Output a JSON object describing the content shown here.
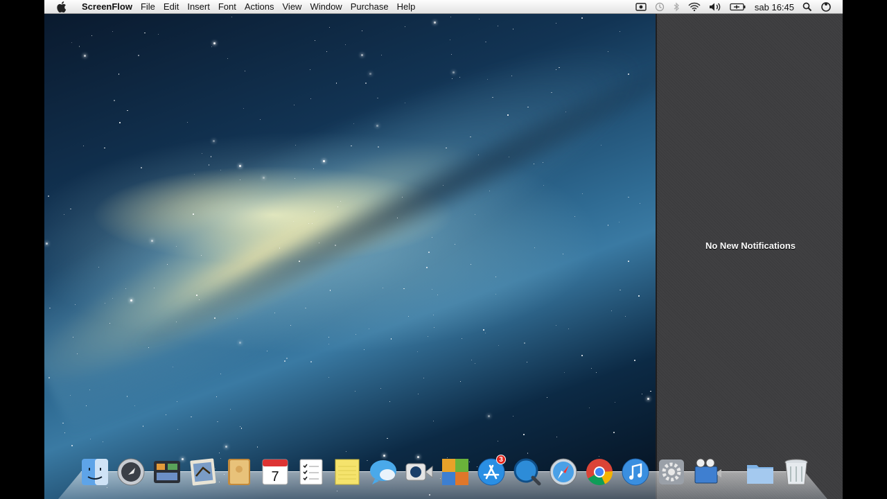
{
  "menubar": {
    "app_name": "ScreenFlow",
    "items": [
      "File",
      "Edit",
      "Insert",
      "Font",
      "Actions",
      "View",
      "Window",
      "Purchase",
      "Help"
    ],
    "clock": "sab 16:45",
    "status_icons": [
      "screenflow-record-icon",
      "time-machine-icon",
      "bluetooth-icon",
      "wifi-icon",
      "volume-icon",
      "battery-icon",
      "spotlight-icon",
      "notification-center-icon"
    ]
  },
  "notification_center": {
    "message": "No New Notifications"
  },
  "dock": {
    "items": [
      {
        "name": "finder-icon"
      },
      {
        "name": "launchpad-icon"
      },
      {
        "name": "mission-control-icon"
      },
      {
        "name": "mail-icon"
      },
      {
        "name": "contacts-icon"
      },
      {
        "name": "calendar-icon",
        "text": "7"
      },
      {
        "name": "reminders-icon"
      },
      {
        "name": "notes-icon"
      },
      {
        "name": "messages-icon"
      },
      {
        "name": "facetime-icon"
      },
      {
        "name": "game-center-icon"
      },
      {
        "name": "app-store-icon",
        "badge": "3"
      },
      {
        "name": "quicktime-icon"
      },
      {
        "name": "safari-icon"
      },
      {
        "name": "chrome-icon"
      },
      {
        "name": "itunes-icon"
      },
      {
        "name": "system-preferences-icon"
      },
      {
        "name": "screenflow-app-icon"
      },
      {
        "name": "documents-folder-icon"
      },
      {
        "name": "trash-icon"
      }
    ]
  },
  "colors": {
    "menubar_bg": "#ededed",
    "notification_bg": "#3e3e40",
    "badge": "#e3241b"
  }
}
